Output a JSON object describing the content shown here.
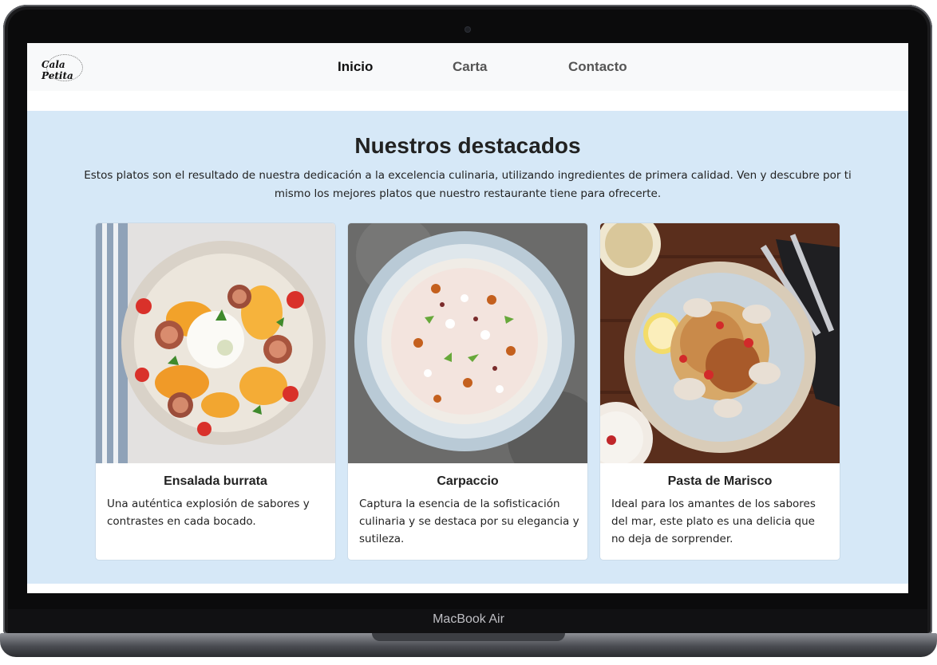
{
  "device": {
    "model_label": "MacBook Air"
  },
  "navbar": {
    "logo": {
      "text": "Cala Petita",
      "icon": "restaurant-logo"
    },
    "links": [
      {
        "label": "Inicio",
        "active": true
      },
      {
        "label": "Carta",
        "active": false
      },
      {
        "label": "Contacto",
        "active": false
      }
    ]
  },
  "featured": {
    "title": "Nuestros destacados",
    "description": "Estos platos son el resultado de nuestra dedicación a la excelencia culinaria, utilizando ingredientes de primera calidad. Ven y descubre por ti mismo los mejores platos que nuestro restaurante tiene para ofrecerte.",
    "background_color": "#d6e8f7",
    "cards": [
      {
        "title": "Ensalada burrata",
        "text": "Una auténtica explosión de sabores y contrastes en cada bocado.",
        "image": "burrata-salad-image"
      },
      {
        "title": "Carpaccio",
        "text": "Captura la esencia de la sofisticación culinaria y se destaca por su elegancia y sutileza.",
        "image": "carpaccio-image"
      },
      {
        "title": "Pasta de Marisco",
        "text": "Ideal para los amantes de los sabores del mar, este plato es una delicia que no deja de sorprender.",
        "image": "seafood-pasta-image"
      }
    ]
  }
}
